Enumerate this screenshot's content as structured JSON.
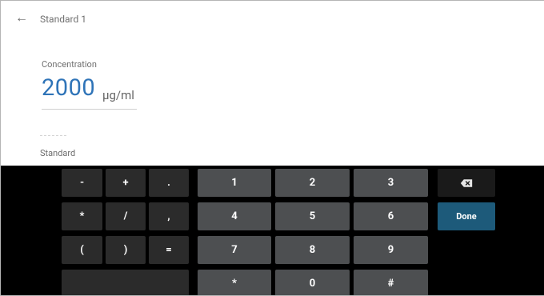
{
  "header": {
    "title": "Standard 1",
    "back_icon": "arrow-left-icon"
  },
  "concentration": {
    "label": "Concentration",
    "value": "2000",
    "unit": "µg/ml"
  },
  "standard": {
    "label": "Standard"
  },
  "keyboard": {
    "symbols": [
      "-",
      "+",
      ".",
      "*",
      "/",
      ",",
      "(",
      ")",
      "="
    ],
    "digits": [
      "1",
      "2",
      "3",
      "4",
      "5",
      "6",
      "7",
      "8",
      "9",
      "*",
      "0",
      "#"
    ],
    "done_label": "Done",
    "backspace_icon": "backspace-icon"
  }
}
